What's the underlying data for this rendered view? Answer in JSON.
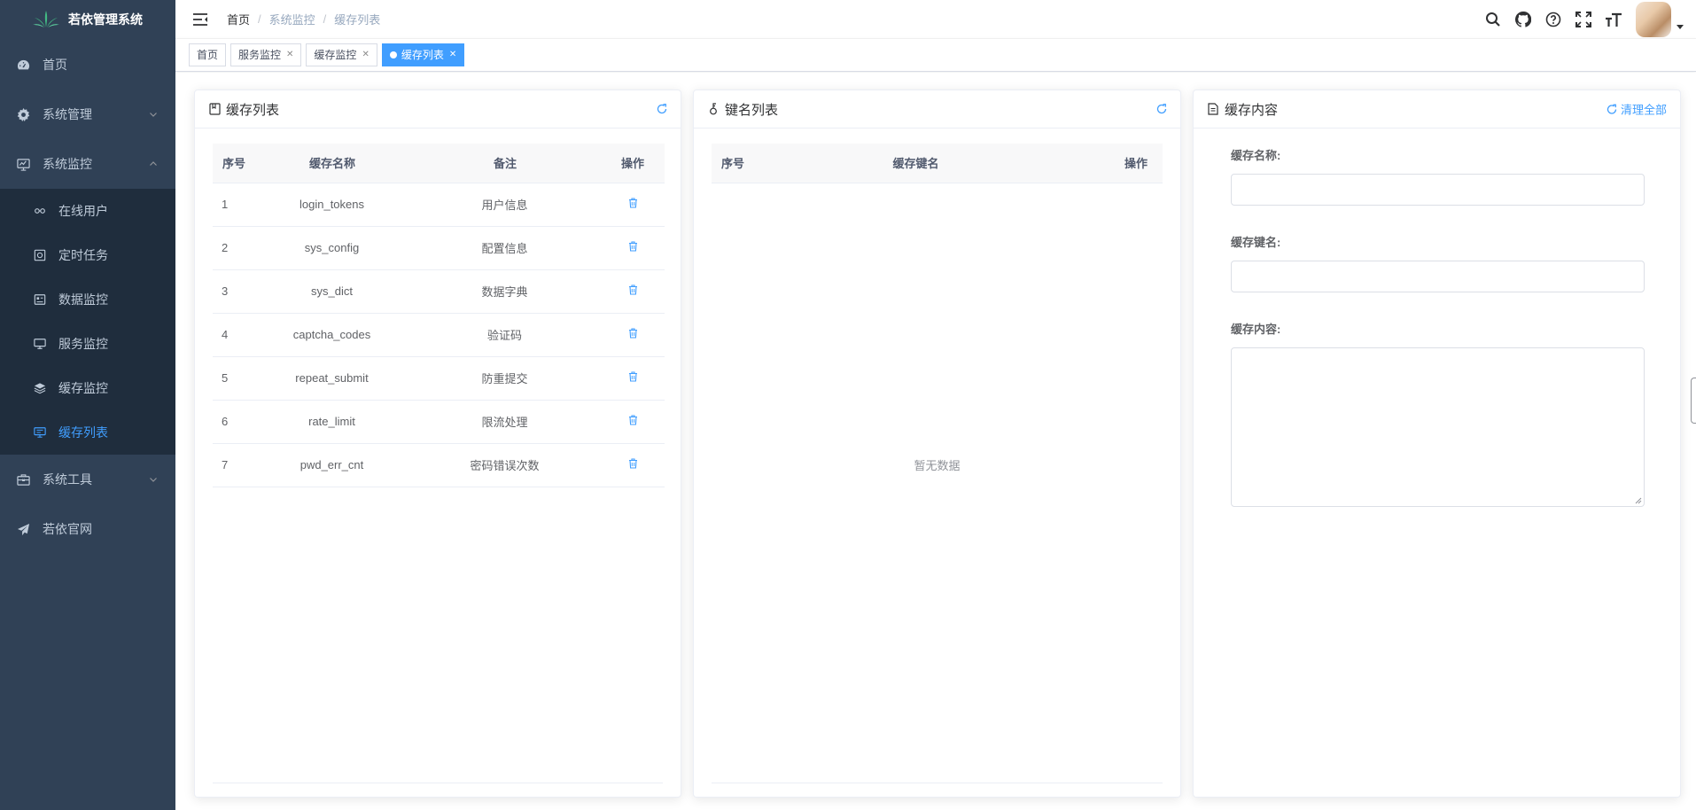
{
  "app": {
    "title": "若依管理系统"
  },
  "sidebar": {
    "items": [
      {
        "label": "首页",
        "icon": "dashboard-icon"
      },
      {
        "label": "系统管理",
        "icon": "gear-icon"
      },
      {
        "label": "系统监控",
        "icon": "monitor-icon"
      },
      {
        "label": "系统工具",
        "icon": "toolbox-icon"
      },
      {
        "label": "若依官网",
        "icon": "paper-plane-icon"
      }
    ],
    "monitor_children": [
      {
        "label": "在线用户",
        "icon": "online-icon"
      },
      {
        "label": "定时任务",
        "icon": "job-icon"
      },
      {
        "label": "数据监控",
        "icon": "druid-icon"
      },
      {
        "label": "服务监控",
        "icon": "server-icon"
      },
      {
        "label": "缓存监控",
        "icon": "redis-icon"
      },
      {
        "label": "缓存列表",
        "icon": "redis-list-icon",
        "active": true
      }
    ]
  },
  "breadcrumb": [
    "首页",
    "系统监控",
    "缓存列表"
  ],
  "tags": [
    {
      "label": "首页",
      "closable": false
    },
    {
      "label": "服务监控",
      "closable": true
    },
    {
      "label": "缓存监控",
      "closable": true
    },
    {
      "label": "缓存列表",
      "closable": true,
      "active": true
    }
  ],
  "cache_list": {
    "title": "缓存列表",
    "columns": [
      "序号",
      "缓存名称",
      "备注",
      "操作"
    ],
    "rows": [
      {
        "index": "1",
        "name": "login_tokens",
        "remark": "用户信息"
      },
      {
        "index": "2",
        "name": "sys_config",
        "remark": "配置信息"
      },
      {
        "index": "3",
        "name": "sys_dict",
        "remark": "数据字典"
      },
      {
        "index": "4",
        "name": "captcha_codes",
        "remark": "验证码"
      },
      {
        "index": "5",
        "name": "repeat_submit",
        "remark": "防重提交"
      },
      {
        "index": "6",
        "name": "rate_limit",
        "remark": "限流处理"
      },
      {
        "index": "7",
        "name": "pwd_err_cnt",
        "remark": "密码错误次数"
      }
    ]
  },
  "key_list": {
    "title": "键名列表",
    "columns": [
      "序号",
      "缓存键名",
      "操作"
    ],
    "empty_text": "暂无数据"
  },
  "cache_content": {
    "title": "缓存内容",
    "clear_all_label": "清理全部",
    "name_label": "缓存名称:",
    "key_label": "缓存键名:",
    "value_label": "缓存内容:",
    "name_value": "",
    "key_value": "",
    "value_value": ""
  },
  "colors": {
    "sidebar_bg": "#304156",
    "submenu_bg": "#1f2d3d",
    "accent": "#409eff"
  }
}
